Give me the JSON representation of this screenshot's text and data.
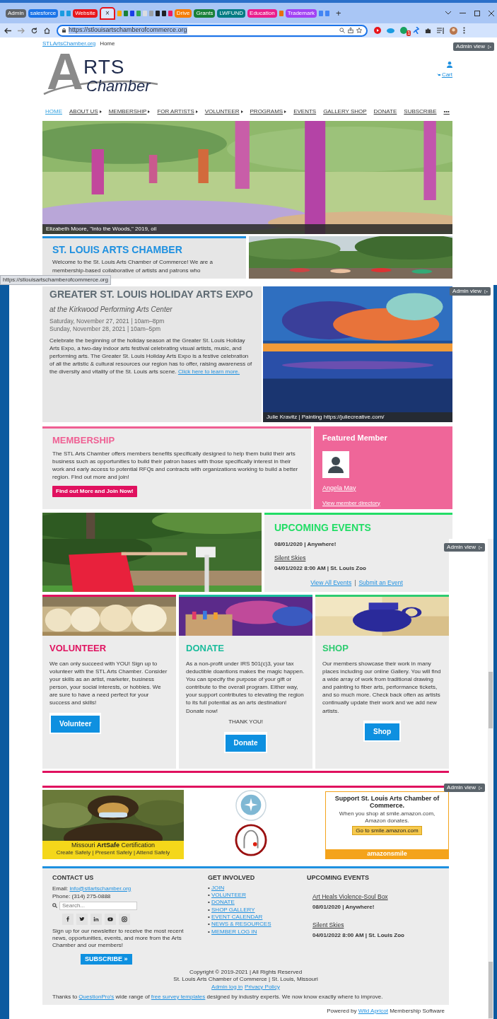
{
  "browser": {
    "tab_strip": [
      {
        "kind": "group",
        "label": "Admin",
        "color": "#5f6368"
      },
      {
        "kind": "group",
        "label": "salesforce",
        "color": "#1a73e8"
      },
      {
        "kind": "favicon",
        "color": "#1a9be0"
      },
      {
        "kind": "favicon",
        "color": "#1a9be0"
      },
      {
        "kind": "group",
        "label": "Website",
        "color": "#e8151b"
      },
      {
        "kind": "active",
        "label": "×"
      },
      {
        "kind": "favicon",
        "color": "#f9ab00"
      },
      {
        "kind": "favicon",
        "color": "#188038"
      },
      {
        "kind": "favicon",
        "color": "#1a3fe8"
      },
      {
        "kind": "favicon",
        "color": "#34a853"
      },
      {
        "kind": "favicon",
        "color": "#dadce0"
      },
      {
        "kind": "favicon",
        "color": "#9aa0a6"
      },
      {
        "kind": "favicon",
        "color": "#202124"
      },
      {
        "kind": "favicon",
        "color": "#202124"
      },
      {
        "kind": "favicon",
        "color": "#e91e63"
      },
      {
        "kind": "group",
        "label": "Drive",
        "color": "#f57c00"
      },
      {
        "kind": "group",
        "label": "Grants",
        "color": "#188038"
      },
      {
        "kind": "group",
        "label": "LWFUND",
        "color": "#007b83"
      },
      {
        "kind": "group",
        "label": "Education",
        "color": "#e91e8c"
      },
      {
        "kind": "favicon",
        "color": "#e8710a"
      },
      {
        "kind": "group",
        "label": "Trademark",
        "color": "#a142f4"
      },
      {
        "kind": "favicon",
        "color": "#4285f4"
      },
      {
        "kind": "favicon",
        "color": "#4285f4"
      },
      {
        "kind": "new",
        "label": "+"
      }
    ],
    "url": "https://stlouisartschamberofcommerce.org",
    "url_selected": true,
    "extension_badge": "1",
    "status_url": "https://stlouisartschamberofcommerce.org"
  },
  "admin_view": [
    "Admin view",
    "Admin view",
    "Admin view",
    "Admin view"
  ],
  "header": {
    "breadcrumb": [
      {
        "label": "STLArtsChamber.org",
        "kind": "link"
      },
      {
        "label": "Home",
        "kind": "current"
      }
    ],
    "logo": {
      "initial": "A",
      "top": "RTS",
      "bottom": "Chamber"
    },
    "cart": "Cart"
  },
  "nav": [
    {
      "label": "HOME",
      "selected": true,
      "submenu": false
    },
    {
      "label": "ABOUT US",
      "selected": false,
      "submenu": true
    },
    {
      "label": "MEMBERSHIP",
      "selected": false,
      "submenu": true
    },
    {
      "label": "FOR ARTISTS",
      "selected": false,
      "submenu": true
    },
    {
      "label": "VOLUNTEER",
      "selected": false,
      "submenu": true
    },
    {
      "label": "PROGRAMS",
      "selected": false,
      "submenu": true
    },
    {
      "label": "EVENTS",
      "selected": false,
      "submenu": false
    },
    {
      "label": "GALLERY SHOP",
      "selected": false,
      "submenu": false
    },
    {
      "label": "DONATE",
      "selected": false,
      "submenu": false
    },
    {
      "label": "SUBSCRIBE",
      "selected": false,
      "submenu": false
    },
    {
      "label": "•••",
      "selected": false,
      "submenu": false
    }
  ],
  "hero": {
    "caption": "Elizabeth Moore, \"Into the Woods,\" 2019, oil"
  },
  "welcome": {
    "title": "ST. LOUIS ARTS CHAMBER",
    "text": "Welcome to the St. Louis Arts Chamber of Commerce! We are a membership-based collaborative of artists and patrons who"
  },
  "expo": {
    "title": "GREATER ST. LOUIS HOLIDAY ARTS EXPO",
    "subtitle": "at the Kirkwood Performing Arts Center",
    "dates": [
      "Saturday, November 27, 2021 | 10am–8pm",
      "Sunday, November 28, 2021 | 10am–5pm"
    ],
    "text": "Celebrate the beginning of the holiday season at the Greater St. Louis Holiday Arts Expo, a two-day indoor arts festival celebrating visual artists, music, and performing arts. The Greater St. Louis Holiday Arts Expo is a festive celebration of all the artistic & cultural resources our region has to offer, raising awareness of the diversity and vitality of the St. Louis arts scene.",
    "link": "Click here to learn more.",
    "caption": "Julie Kravitz | Painting https://juliecreative.com/"
  },
  "membership": {
    "title": "MEMBERSHIP",
    "text": "The STL Arts Chamber offers members benefits specifically designed to help them build their arts business such as opportunities to build their patron bases with those specifically interest in their work and early access to potential RFQs and contracts with organizations working to build a better region. Find out more and join!",
    "button": "Find out More and Join Now!"
  },
  "featured_member": {
    "title": "Featured Member",
    "name": "Angela May",
    "link": "View member directory"
  },
  "upcoming_events": {
    "title": "UPCOMING EVENTS",
    "events": [
      {
        "date": "08/01/2020 | Anywhere!"
      },
      {
        "name": "Silent Skies",
        "date": "04/01/2022 8:00 AM | St. Louis Zoo"
      }
    ],
    "links": [
      "View All Events",
      "Submit an Event"
    ],
    "separator": "|"
  },
  "features": [
    {
      "title": "VOLUNTEER",
      "color": "#e0115f",
      "text": "We can only succeed with YOU! Sign up to volunteer with the STL Arts Chamber. Consider your skills as an artist, marketer, business person, your social interests, or hobbies. We are sure to have a need perfect for your success and skills!",
      "button": "Volunteer"
    },
    {
      "title": "DONATE",
      "color": "#1abc9c",
      "text": "As a non-profit under IRS 501(c)3, your tax deductible doantions makes the magic happen. You can specify the purpose of your gift or contribute to the overall program. Either way, your support contributes to elevating the region to its full potential as an arts destination! Donate now!",
      "note": "THANK YOU!",
      "button": "Donate"
    },
    {
      "title": "SHOP",
      "color": "#2ecc71",
      "text": "Our members showcase their work in many places including our online Gallery. You will find a wide array of work from traditional drawing and painting to fiber arts, performance tickets, and so much more. Check back often as artists continually update their work and we add new artists.",
      "button": "Shop"
    }
  ],
  "artsafe": {
    "title": "Missouri **ArtSafe** Certification",
    "tagline": "Create Safely | Present Safely | Attend Safely"
  },
  "amazon": {
    "heading": "Support St. Louis Arts Chamber of Commerce.",
    "lines": [
      "When you shop at smile.amazon.com,",
      "Amazon donates."
    ],
    "button": "Go to smile.amazon.com",
    "brand": "amazonsmile"
  },
  "footer": {
    "contact": {
      "title": "CONTACT US",
      "email_label": "Email:",
      "email": "info@stlartschamber.org",
      "phone": "Phone: (314) 275-0888",
      "search_placeholder": "Search...",
      "signup": "Sign up for our newsletter to receive the most recent news, opportunities, events, and more from the Arts Chamber and our members!",
      "subscribe": "SUBSCRIBE »"
    },
    "get_involved": {
      "title": "GET INVOLVED",
      "bullet": "•",
      "links": [
        "JOIN",
        "VOLUNTEER",
        "DONATE",
        "SHOP GALLERY",
        "EVENT CALENDAR",
        "NEWS & RESOURCES",
        "MEMBER LOG IN"
      ]
    },
    "events": {
      "title": "UPCOMING EVENTS",
      "items": [
        {
          "name": "Art Heals Violence-Soul Box",
          "date": "08/01/2020 | Anywhere!"
        },
        {
          "name": "Silent Skies",
          "date": "04/01/2022 8:00 AM | St. Louis Zoo"
        }
      ]
    },
    "copyright": [
      "Copyright © 2019-2021 | All Rights Reserved",
      "St. Louis Arts Chamber of Commerce | St. Louis, Missouri"
    ],
    "legal_links": [
      "Admin log in",
      "Privacy Policy"
    ],
    "thanks": [
      {
        "text": "Thanks to ",
        "kind": "text"
      },
      {
        "text": "QuestionPro's",
        "kind": "link"
      },
      {
        "text": " wide range of ",
        "kind": "text"
      },
      {
        "text": "free survey templates",
        "kind": "link"
      },
      {
        "text": " designed by industry experts. We now know exactly where to improve.",
        "kind": "text"
      }
    ],
    "powered": [
      {
        "text": "Powered by ",
        "kind": "text"
      },
      {
        "text": "Wild Apricot",
        "kind": "link"
      },
      {
        "text": " Membership Software",
        "kind": "text"
      }
    ]
  }
}
